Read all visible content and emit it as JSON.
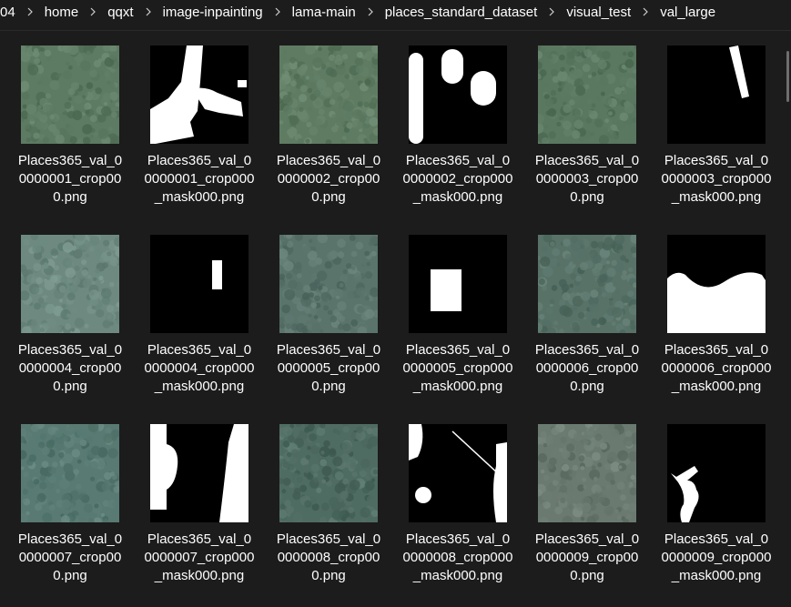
{
  "breadcrumb": {
    "items": [
      "04",
      "home",
      "qqxt",
      "image-inpainting",
      "lama-main",
      "places_standard_dataset",
      "visual_test",
      "val_large"
    ]
  },
  "colors": {
    "background": "#1c1c1c",
    "text": "#ffffff",
    "mask_fill": "#ffffff",
    "mask_background": "#000000"
  },
  "files": [
    {
      "name": "Places365_val_00000001_crop000.png",
      "kind": "image",
      "tone": "#5d7a62"
    },
    {
      "name": "Places365_val_00000001_crop000_mask000.png",
      "kind": "mask",
      "mask": "m1"
    },
    {
      "name": "Places365_val_00000002_crop000.png",
      "kind": "image",
      "tone": "#5f7c63"
    },
    {
      "name": "Places365_val_00000002_crop000_mask000.png",
      "kind": "mask",
      "mask": "m2"
    },
    {
      "name": "Places365_val_00000003_crop000.png",
      "kind": "image",
      "tone": "#5a7760"
    },
    {
      "name": "Places365_val_00000003_crop000_mask000.png",
      "kind": "mask",
      "mask": "m3"
    },
    {
      "name": "Places365_val_00000004_crop000.png",
      "kind": "image",
      "tone": "#6e8a80"
    },
    {
      "name": "Places365_val_00000004_crop000_mask000.png",
      "kind": "mask",
      "mask": "m4"
    },
    {
      "name": "Places365_val_00000005_crop000.png",
      "kind": "image",
      "tone": "#5a746c"
    },
    {
      "name": "Places365_val_00000005_crop000_mask000.png",
      "kind": "mask",
      "mask": "m5"
    },
    {
      "name": "Places365_val_00000006_crop000.png",
      "kind": "image",
      "tone": "#587268"
    },
    {
      "name": "Places365_val_00000006_crop000_mask000.png",
      "kind": "mask",
      "mask": "m6"
    },
    {
      "name": "Places365_val_00000007_crop000.png",
      "kind": "image",
      "tone": "#587a72"
    },
    {
      "name": "Places365_val_00000007_crop000_mask000.png",
      "kind": "mask",
      "mask": "m7"
    },
    {
      "name": "Places365_val_00000008_crop000.png",
      "kind": "image",
      "tone": "#4f6c62"
    },
    {
      "name": "Places365_val_00000008_crop000_mask000.png",
      "kind": "mask",
      "mask": "m8"
    },
    {
      "name": "Places365_val_00000009_crop000.png",
      "kind": "image",
      "tone": "#6a7a70"
    },
    {
      "name": "Places365_val_00000009_crop000_mask000.png",
      "kind": "mask",
      "mask": "m9"
    }
  ]
}
